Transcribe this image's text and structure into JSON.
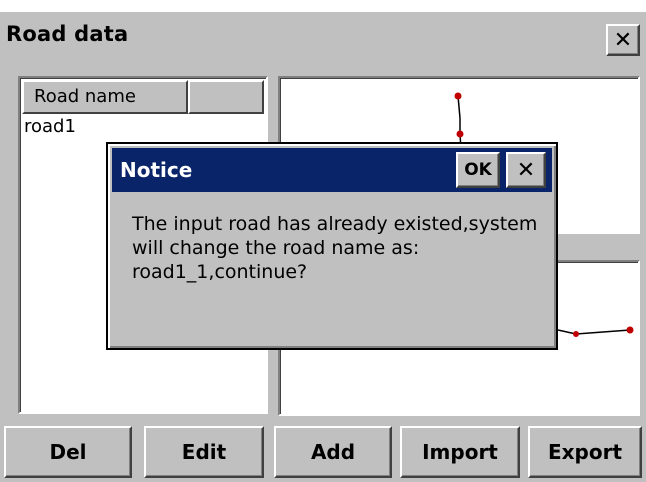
{
  "window": {
    "title": "Road data",
    "close_glyph": "✕"
  },
  "road_list": {
    "columns": [
      "Road name",
      ""
    ],
    "rows": [
      "road1"
    ]
  },
  "buttons": {
    "del": "Del",
    "edit": "Edit",
    "add": "Add",
    "import": "Import",
    "export": "Export"
  },
  "dialog": {
    "title": "Notice",
    "ok_label": "OK",
    "close_glyph": "✕",
    "message": "The input road has already existed,system will change the road name as: road1_1,continue?"
  },
  "colors": {
    "dialog_titlebar": "#0a246a",
    "road_line": "#000000",
    "road_node": "#c00000"
  }
}
